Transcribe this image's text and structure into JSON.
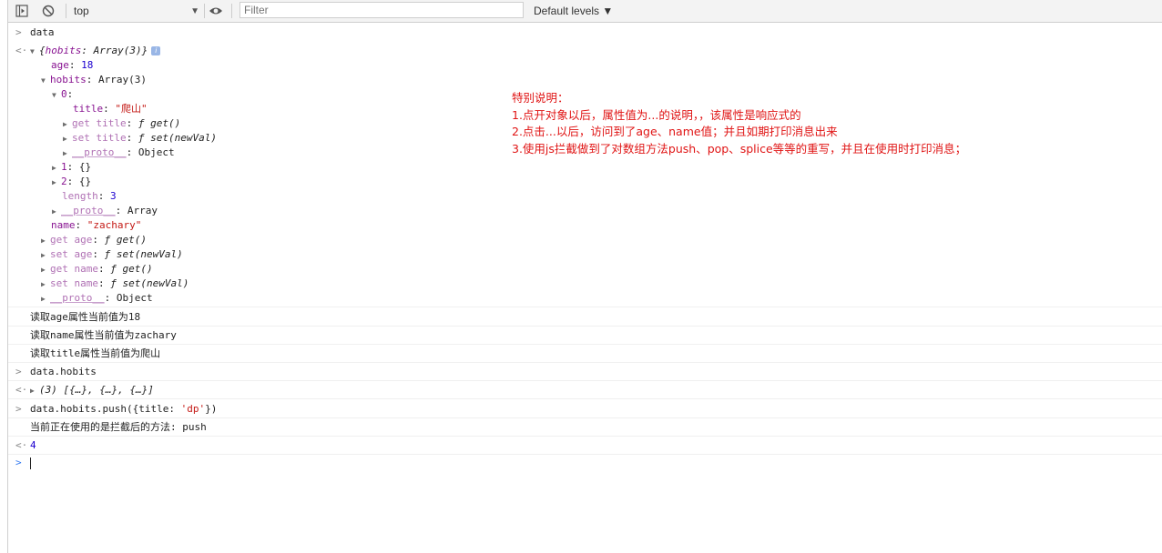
{
  "toolbar": {
    "context_label": "top",
    "context_caret": "▼",
    "filter_placeholder": "Filter",
    "levels_label": "Default levels ▼"
  },
  "console": {
    "input1": "data",
    "obj_preview_key": "hobits",
    "obj_preview_value": "Array(3)",
    "obj_info_glyph": "i",
    "age": {
      "key": "age",
      "value": "18"
    },
    "hobits": {
      "key": "hobits",
      "value": "Array(3)"
    },
    "item0": {
      "key": "0"
    },
    "title": {
      "key": "title",
      "value": "\"爬山\""
    },
    "get_title": {
      "key": "get title",
      "value": "get()"
    },
    "set_title": {
      "key": "set title",
      "value": "set(newVal)"
    },
    "proto_item": {
      "key": "__proto__",
      "value": "Object"
    },
    "item1": {
      "key": "1",
      "value": "{}"
    },
    "item2": {
      "key": "2",
      "value": "{}"
    },
    "length": {
      "key": "length",
      "value": "3"
    },
    "proto_array": {
      "key": "__proto__",
      "value": "Array"
    },
    "name": {
      "key": "name",
      "value": "\"zachary\""
    },
    "get_age": {
      "key": "get age",
      "value": "get()"
    },
    "set_age": {
      "key": "set age",
      "value": "set(newVal)"
    },
    "get_name": {
      "key": "get name",
      "value": "get()"
    },
    "set_name": {
      "key": "set name",
      "value": "set(newVal)"
    },
    "proto_obj": {
      "key": "__proto__",
      "value": "Object"
    },
    "log1": "读取age属性当前值为18",
    "log2": "读取name属性当前值为zachary",
    "log3": "读取title属性当前值为爬山",
    "input2": "data.hobits",
    "result2": "(3) [{…}, {…}, {…}]",
    "input3_pre": "data.hobits.push({title: ",
    "input3_str": "'dp'",
    "input3_post": "})",
    "log4": "当前正在使用的是拦截后的方法: push",
    "result3": "4"
  },
  "annotation": {
    "heading": "特别说明：",
    "line1": "1.点开对象以后，属性值为...的说明，，该属性是响应式的",
    "line2": "2.点击...以后，访问到了age、name值；并且如期打印消息出来",
    "line3": "3.使用js拦截做到了对数组方法push、pop、splice等等的重写，并且在使用时打印消息；"
  }
}
